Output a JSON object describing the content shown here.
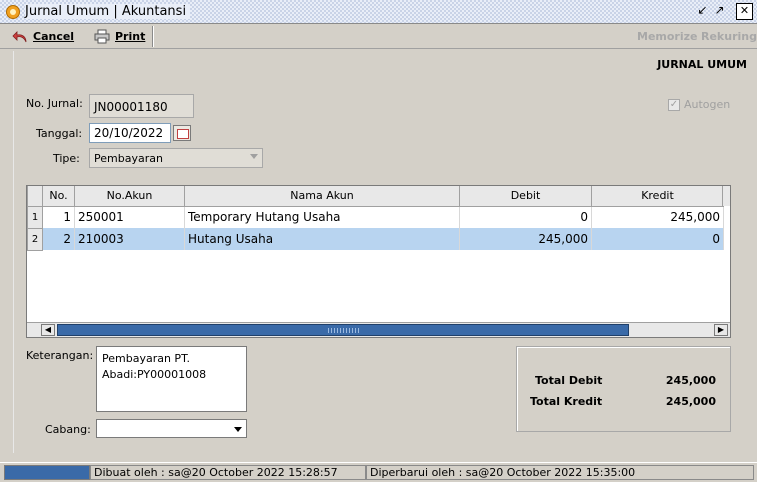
{
  "window": {
    "title": "Jurnal Umum | Akuntansi",
    "min_icon": "restore-down-icon",
    "max_icon": "maximize-icon",
    "close_icon": "close-icon"
  },
  "toolbar": {
    "cancel_label": "Cancel",
    "print_label": "Print",
    "memorize_label": "Memorize",
    "rekuring_label": "Rekuring"
  },
  "form": {
    "heading": "JURNAL UMUM",
    "no_jurnal_label": "No. Jurnal:",
    "no_jurnal_value": "JN00001180",
    "tanggal_label": "Tanggal:",
    "tanggal_value": "20/10/2022",
    "tipe_label": "Tipe:",
    "tipe_value": "Pembayaran",
    "autogen_label": "Autogen",
    "autogen_checked": true
  },
  "grid": {
    "columns": [
      "No.",
      "No.Akun",
      "Nama Akun",
      "Debit",
      "Kredit"
    ],
    "rows": [
      {
        "row": "1",
        "no": "1",
        "akun": "250001",
        "nama": "Temporary Hutang Usaha",
        "debit": "0",
        "kredit": "245,000",
        "selected": false
      },
      {
        "row": "2",
        "no": "2",
        "akun": "210003",
        "nama": "Hutang Usaha",
        "debit": "245,000",
        "kredit": "0",
        "selected": true
      }
    ]
  },
  "footer": {
    "keterangan_label": "Keterangan:",
    "keterangan_line1": "Pembayaran PT.",
    "keterangan_line2": "Abadi:PY00001008",
    "cabang_label": "Cabang:",
    "cabang_value": "",
    "total_debit_label": "Total Debit",
    "total_debit_value": "245,000",
    "total_kredit_label": "Total Kredit",
    "total_kredit_value": "245,000"
  },
  "status": {
    "created": "Dibuat oleh : sa@20 October 2022  15:28:57",
    "updated": "Diperbarui oleh : sa@20 October 2022  15:35:00"
  },
  "colors": {
    "selection": "#b8d4f0",
    "scroll_thumb": "#3a6aa8",
    "panel": "#d4d0c8"
  }
}
